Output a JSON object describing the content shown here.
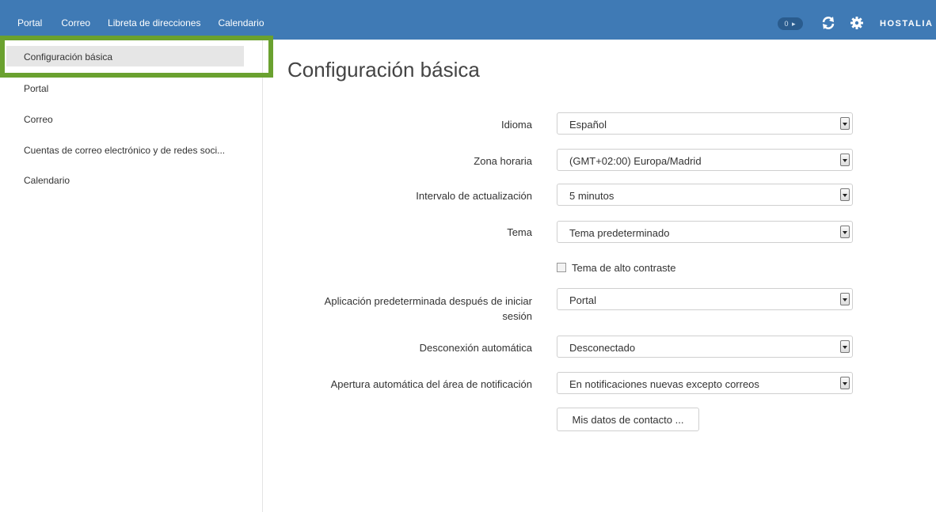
{
  "topnav": {
    "items": [
      "Portal",
      "Correo",
      "Libreta de direcciones",
      "Calendario"
    ],
    "notifications": "0 ▸",
    "brand": "HOSTALIA"
  },
  "sidebar": {
    "items": [
      {
        "label": "Configuración básica",
        "active": true
      },
      {
        "label": "Portal"
      },
      {
        "label": "Correo"
      },
      {
        "label": "Cuentas de correo electrónico y de redes soci..."
      },
      {
        "label": "Calendario"
      }
    ]
  },
  "main": {
    "title": "Configuración básica",
    "fields": {
      "idioma": {
        "label": "Idioma",
        "value": "Español"
      },
      "zona": {
        "label": "Zona horaria",
        "value": "(GMT+02:00) Europa/Madrid"
      },
      "intervalo": {
        "label": "Intervalo de actualización",
        "value": "5 minutos"
      },
      "tema": {
        "label": "Tema",
        "value": "Tema predeterminado"
      },
      "alto_contraste": {
        "label": "Tema de alto contraste",
        "checked": false
      },
      "aplicacion": {
        "label_line1": "Aplicación predeterminada después de iniciar",
        "label_line2": "sesión",
        "value": "Portal"
      },
      "desconexion": {
        "label": "Desconexión automática",
        "value": "Desconectado"
      },
      "apertura": {
        "label": "Apertura automática del área de notificación",
        "value": "En notificaciones nuevas excepto correos"
      }
    },
    "contact_button": "Mis datos de contacto ..."
  },
  "colors": {
    "topbar": "#3f7ab5",
    "highlight": "#6aa12f"
  }
}
